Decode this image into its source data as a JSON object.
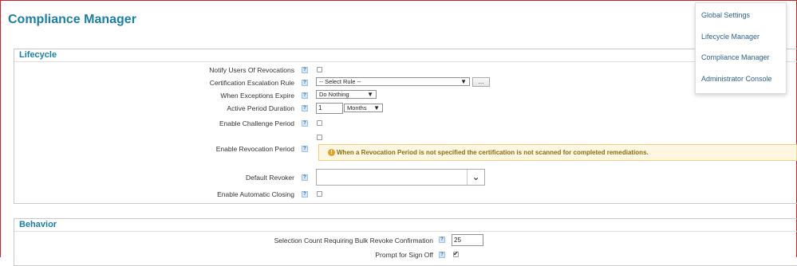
{
  "page_title": "Compliance Manager",
  "lifecycle": {
    "title": "Lifecycle",
    "notify_label": "Notify Users Of Revocations",
    "escalation_label": "Certification Escalation Rule",
    "escalation_value": "-- Select Rule --",
    "escalation_button": "...",
    "exceptions_label": "When Exceptions Expire",
    "exceptions_value": "Do Nothing",
    "active_label": "Active Period Duration",
    "active_value": "1",
    "active_unit": "Months",
    "challenge_label": "Enable Challenge Period",
    "revocation_label": "Enable Revocation Period",
    "revocation_warning": "When a Revocation Period is not specified the certification is not scanned for completed remediations.",
    "revoker_label": "Default Revoker",
    "revoker_value": "",
    "auto_close_label": "Enable Automatic Closing"
  },
  "behavior": {
    "title": "Behavior",
    "bulk_label": "Selection Count Requiring Bulk Revoke Confirmation",
    "bulk_value": "25",
    "signoff_label": "Prompt for Sign Off"
  },
  "help_glyph": "?",
  "menu": {
    "items": [
      "Global Settings",
      "Lifecycle Manager",
      "Compliance Manager",
      "Administrator Console"
    ]
  }
}
